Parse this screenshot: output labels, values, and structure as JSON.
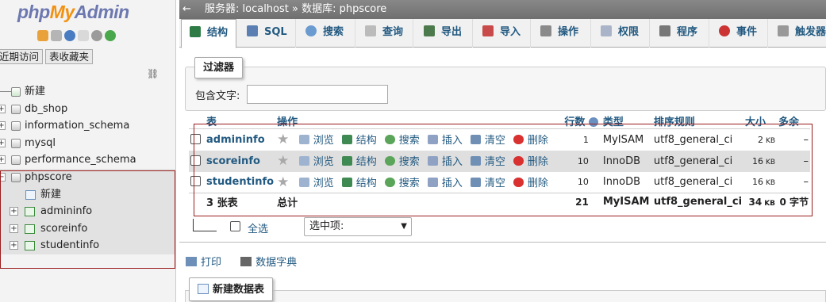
{
  "logo": {
    "php": "php",
    "my": "My",
    "admin": "Admin"
  },
  "left_tabs": [
    "近期访问",
    "表收藏夹"
  ],
  "tree": {
    "new": "新建",
    "dbs": [
      "db_shop",
      "information_schema",
      "mysql",
      "performance_schema"
    ],
    "current_db": "phpscore",
    "current_new": "新建",
    "tables": [
      "admininfo",
      "scoreinfo",
      "studentinfo"
    ]
  },
  "breadcrumb": "服务器: localhost » 数据库: phpscore",
  "tabs": [
    "结构",
    "SQL",
    "搜索",
    "查询",
    "导出",
    "导入",
    "操作",
    "权限",
    "程序",
    "事件",
    "触发器"
  ],
  "filter": {
    "legend": "过滤器",
    "label": "包含文字:",
    "value": ""
  },
  "table": {
    "headers": {
      "name": "表",
      "actions": "操作",
      "rows": "行数",
      "type": "类型",
      "collation": "排序规则",
      "size": "大小",
      "overhead": "多余"
    },
    "action_labels": [
      "浏览",
      "结构",
      "搜索",
      "插入",
      "清空",
      "删除"
    ],
    "rows": [
      {
        "name": "admininfo",
        "rows": "1",
        "type": "MyISAM",
        "collation": "utf8_general_ci",
        "size": "2",
        "unit": "KB",
        "overhead": "–"
      },
      {
        "name": "scoreinfo",
        "rows": "10",
        "type": "InnoDB",
        "collation": "utf8_general_ci",
        "size": "16",
        "unit": "KB",
        "overhead": "–"
      },
      {
        "name": "studentinfo",
        "rows": "10",
        "type": "InnoDB",
        "collation": "utf8_general_ci",
        "size": "16",
        "unit": "KB",
        "overhead": "–"
      }
    ],
    "footer": {
      "count": "3 张表",
      "label": "总计",
      "rows": "21",
      "type": "MyISAM",
      "collation": "utf8_general_ci",
      "size": "34",
      "unit": "KB",
      "overhead": "0 字节"
    }
  },
  "check_all": "全选",
  "with_selected": "选中项:",
  "print": "打印",
  "data_dict": "数据字典",
  "new_table": "新建数据表"
}
